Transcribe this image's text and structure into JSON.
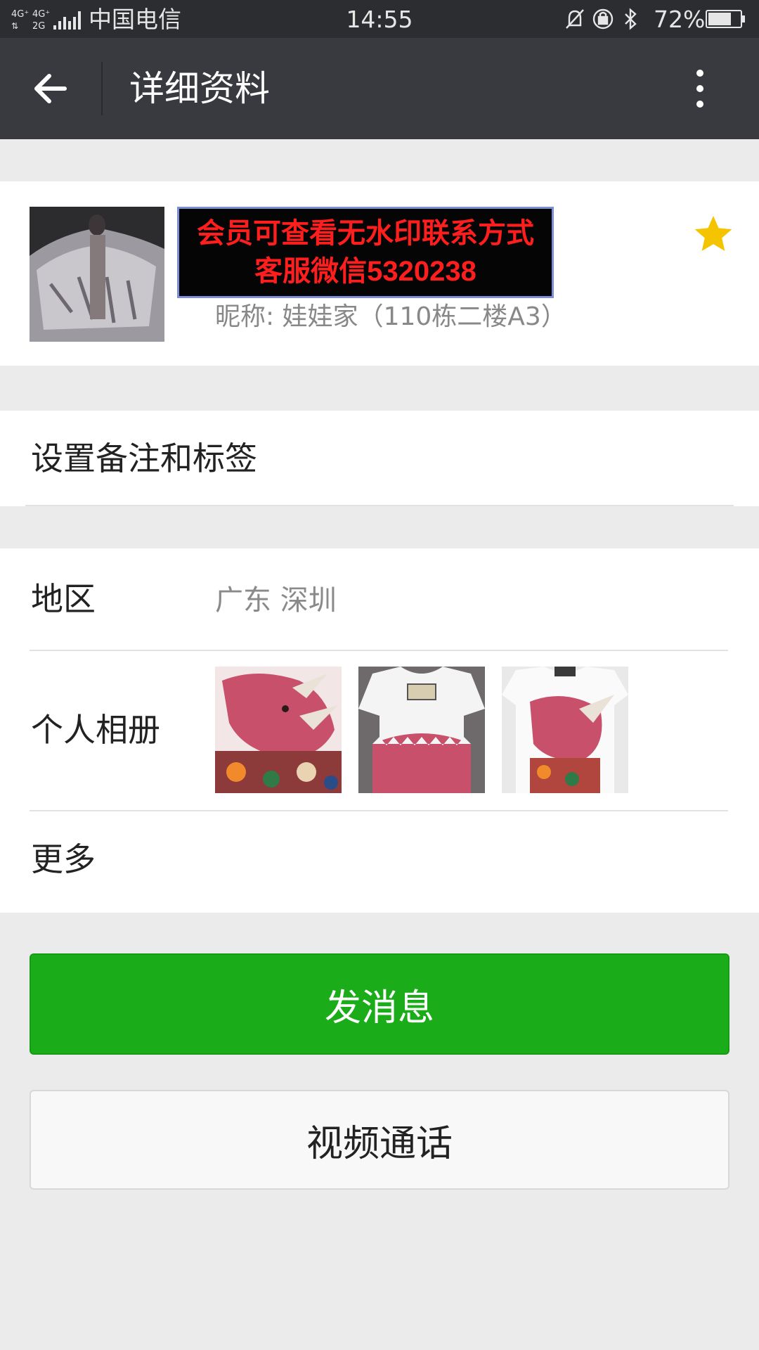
{
  "status_bar": {
    "network_labels": [
      "4G⁺",
      "4G⁺",
      "2G"
    ],
    "carrier": "中国电信",
    "time": "14:55",
    "icons": [
      "mute-icon",
      "rotation-lock-icon",
      "bluetooth-icon"
    ],
    "battery_percent": "72%",
    "battery_level": 0.72
  },
  "toolbar": {
    "back_icon": "arrow-left-icon",
    "title": "详细资料",
    "more_icon": "more-vertical-icon"
  },
  "profile": {
    "avatar_icon": "avatar-image",
    "watermark_line1": "会员可查看无水印联系方式",
    "watermark_line2": "客服微信5320238",
    "nickname": "昵称: 娃娃家（110栋二楼A3）",
    "star_icon": "star-icon",
    "star_color": "#f5c400"
  },
  "remark": {
    "label": "设置备注和标签"
  },
  "info": {
    "region_label": "地区",
    "region_value": "广东  深圳",
    "album_label": "个人相册",
    "album_photos": [
      "dinosaur-print-closeup",
      "white-tshirt-front",
      "white-tshirt-dinosaur"
    ],
    "more_label": "更多"
  },
  "actions": {
    "send_message": "发消息",
    "video_call": "视频通话",
    "send_color": "#1aad19"
  }
}
